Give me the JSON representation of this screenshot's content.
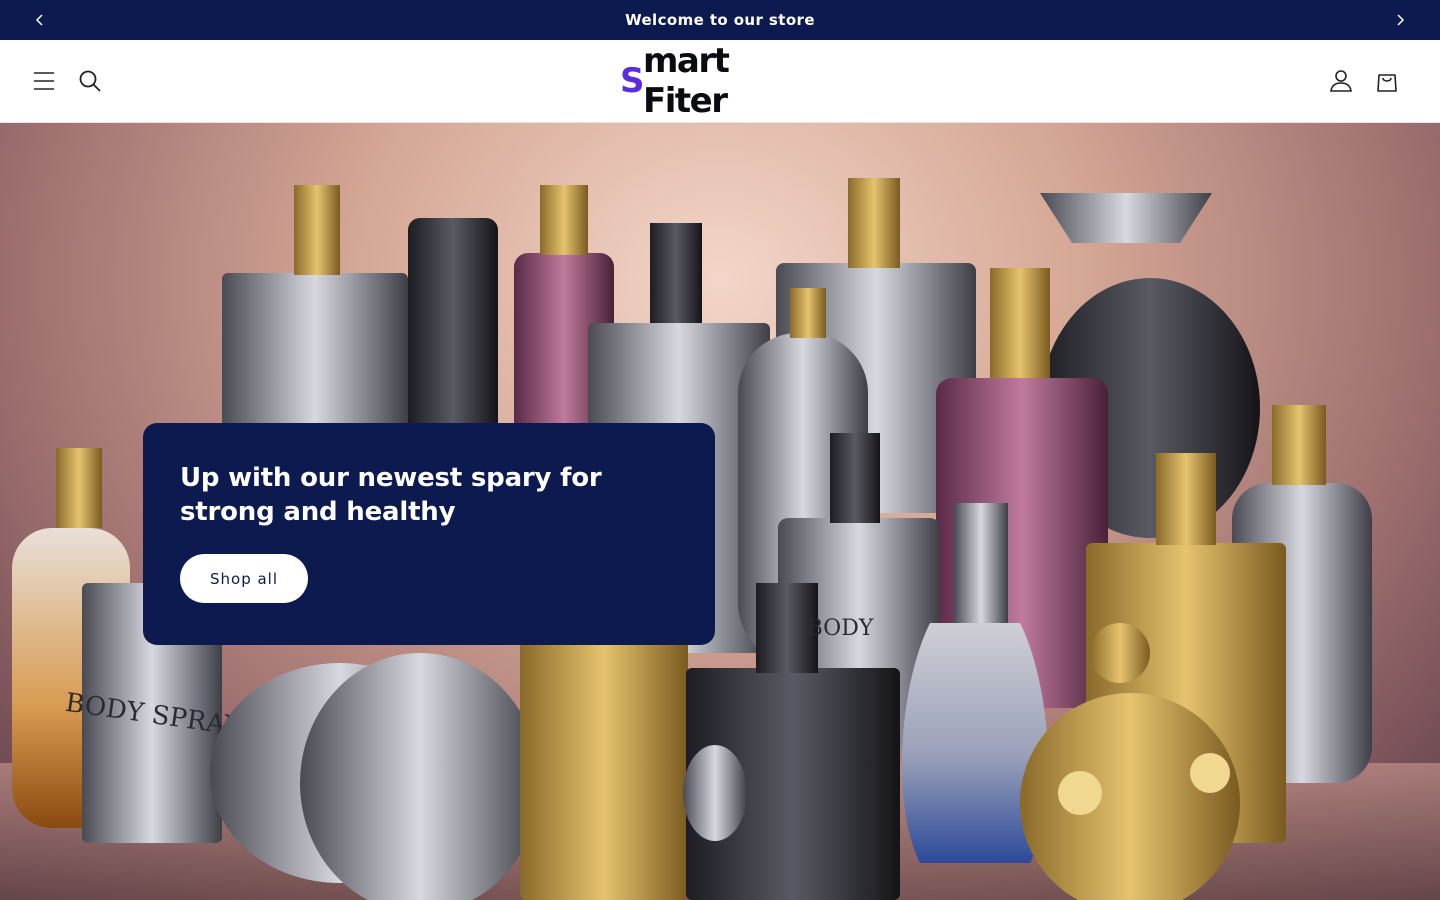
{
  "announcement": {
    "message": "Welcome to our store"
  },
  "header": {
    "logo_accent": "S",
    "logo_rest": "mart Fiter",
    "icons": {
      "menu": "hamburger-menu-icon",
      "search": "search-icon",
      "account": "account-user-icon",
      "cart": "shopping-bag-icon"
    }
  },
  "hero": {
    "heading": "Up with our newest spary for strong and healthy",
    "button_label": "Shop all",
    "bottle_label_left": "BODY SPRAY",
    "bottle_label_center": "BODY"
  },
  "colors": {
    "brand_navy": "#0c1a4f",
    "logo_accent": "#5b2be0",
    "white": "#ffffff"
  }
}
